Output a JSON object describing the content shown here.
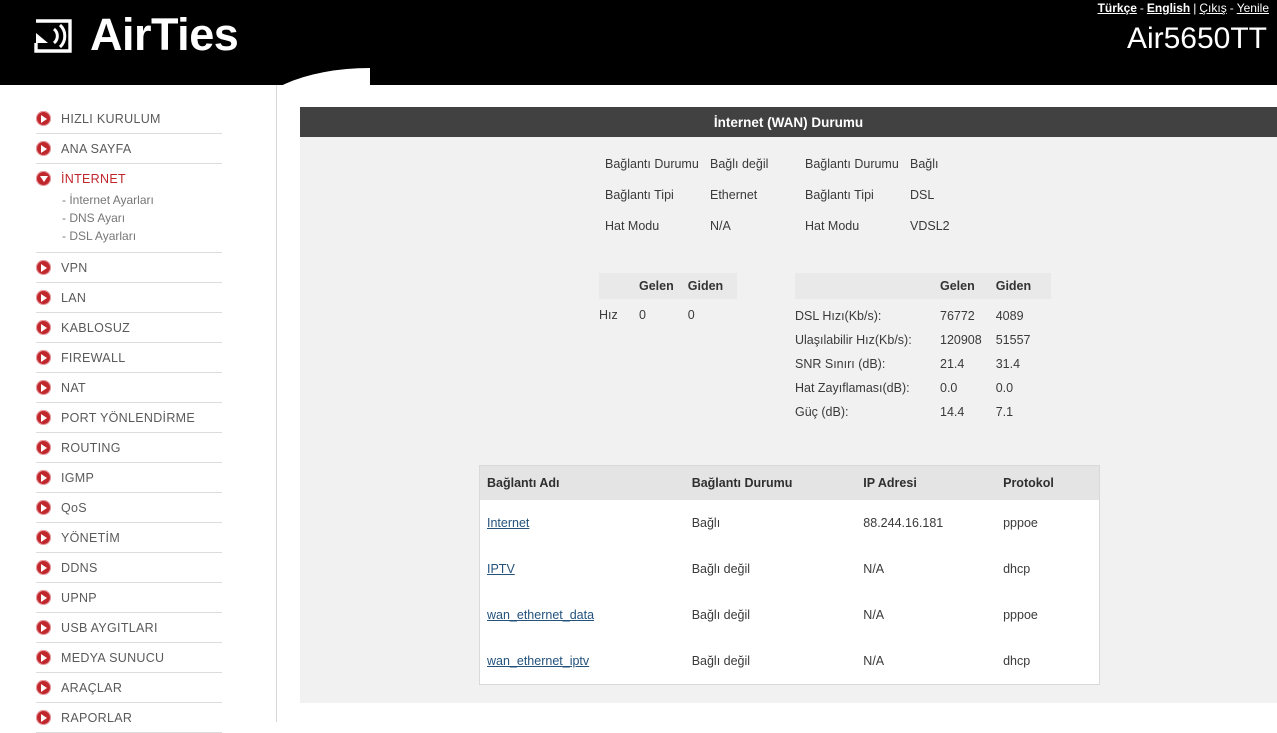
{
  "header": {
    "logo_text": "AirTies",
    "logo_icon": "airties-wifi-logo-icon",
    "model_name": "Air5650TT",
    "toplinks": {
      "lang_tr": "Türkçe",
      "dash": "-",
      "lang_en": "English",
      "pipe": "|",
      "logout": "Çıkış",
      "dash2": "-",
      "refresh": "Yenile"
    }
  },
  "sidebar": {
    "items": [
      {
        "label": "HIZLI KURULUM",
        "expanded": false
      },
      {
        "label": "ANA SAYFA",
        "expanded": false
      },
      {
        "label": "İNTERNET",
        "expanded": true,
        "active": true,
        "subitems": [
          "- İnternet Ayarları",
          "- DNS Ayarı",
          "- DSL Ayarları"
        ]
      },
      {
        "label": "VPN",
        "expanded": false
      },
      {
        "label": "LAN",
        "expanded": false
      },
      {
        "label": "KABLOSUZ",
        "expanded": false
      },
      {
        "label": "FIREWALL",
        "expanded": false
      },
      {
        "label": "NAT",
        "expanded": false
      },
      {
        "label": "PORT YÖNLENDİRME",
        "expanded": false
      },
      {
        "label": "ROUTING",
        "expanded": false
      },
      {
        "label": "IGMP",
        "expanded": false
      },
      {
        "label": "QoS",
        "expanded": false
      },
      {
        "label": "YÖNETİM",
        "expanded": false
      },
      {
        "label": "DDNS",
        "expanded": false
      },
      {
        "label": "UPNP",
        "expanded": false
      },
      {
        "label": "USB AYGITLARI",
        "expanded": false
      },
      {
        "label": "MEDYA SUNUCU",
        "expanded": false
      },
      {
        "label": "ARAÇLAR",
        "expanded": false
      },
      {
        "label": "RAPORLAR",
        "expanded": false
      }
    ]
  },
  "content": {
    "title": "İnternet (WAN) Durumu",
    "status_groups": [
      {
        "rows": [
          {
            "label": "Bağlantı Durumu",
            "value": "Bağlı değil"
          },
          {
            "label": "Bağlantı Tipi",
            "value": "Ethernet"
          },
          {
            "label": "Hat Modu",
            "value": "N/A"
          }
        ]
      },
      {
        "rows": [
          {
            "label": "Bağlantı Durumu",
            "value": "Bağlı"
          },
          {
            "label": "Bağlantı Tipi",
            "value": "DSL"
          },
          {
            "label": "Hat Modu",
            "value": "VDSL2"
          }
        ]
      }
    ],
    "speed_left": {
      "headers": [
        "",
        "Gelen",
        "Giden"
      ],
      "rows": [
        {
          "label": "Hız",
          "in": "0",
          "out": "0"
        }
      ]
    },
    "speed_right": {
      "headers": [
        "",
        "Gelen",
        "Giden"
      ],
      "rows": [
        {
          "label": "DSL Hızı(Kb/s):",
          "in": "76772",
          "out": "4089"
        },
        {
          "label": "Ulaşılabilir Hız(Kb/s):",
          "in": "120908",
          "out": "51557"
        },
        {
          "label": "SNR Sınırı (dB):",
          "in": "21.4",
          "out": "31.4"
        },
        {
          "label": "Hat Zayıflaması(dB):",
          "in": "0.0",
          "out": "0.0"
        },
        {
          "label": "Güç (dB):",
          "in": "14.4",
          "out": "7.1"
        }
      ]
    },
    "connections": {
      "headers": [
        "Bağlantı Adı",
        "Bağlantı Durumu",
        "IP Adresi",
        "Protokol"
      ],
      "rows": [
        {
          "name": "Internet",
          "status": "Bağlı",
          "ip": "88.244.16.181",
          "protocol": "pppoe"
        },
        {
          "name": "IPTV",
          "status": "Bağlı değil",
          "ip": "N/A",
          "protocol": "dhcp"
        },
        {
          "name": "wan_ethernet_data",
          "status": "Bağlı değil",
          "ip": "N/A",
          "protocol": "pppoe"
        },
        {
          "name": "wan_ethernet_iptv",
          "status": "Bağlı değil",
          "ip": "N/A",
          "protocol": "dhcp"
        }
      ]
    }
  },
  "colors": {
    "header_bg": "#000000",
    "accent_red": "#c0272d",
    "title_bar": "#414141",
    "content_bg": "#f1f1f1",
    "table_head": "#e4e4e4",
    "link": "#23527c"
  }
}
